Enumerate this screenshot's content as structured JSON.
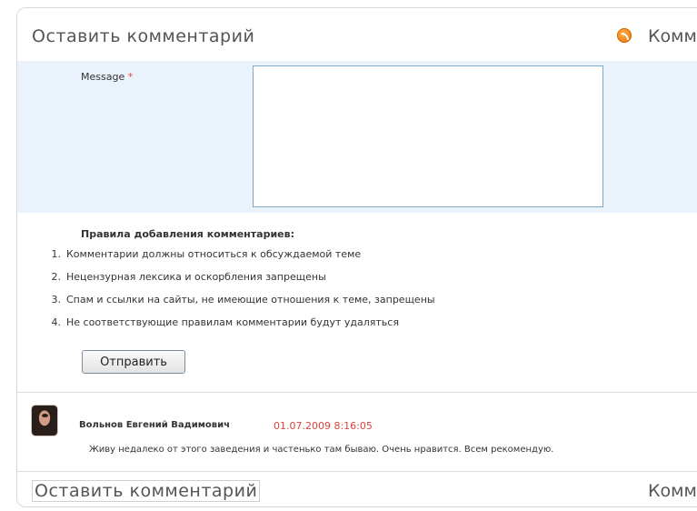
{
  "header": {
    "title": "Оставить комментарий",
    "comments_label": "Комм",
    "rss_icon": "rss-icon"
  },
  "form": {
    "message_label": "Message",
    "required_mark": "*",
    "message_value": ""
  },
  "rules": {
    "title": "Правила добавления комментариев:",
    "items": [
      {
        "num": "1.",
        "text": "Комментарии должны относиться к обсуждаемой теме"
      },
      {
        "num": "2.",
        "text": "Нецензурная лексика и оскорбления запрещены"
      },
      {
        "num": "3.",
        "text": "Спам и ссылки на сайты, не имеющие отношения к теме, запрещены"
      },
      {
        "num": "4.",
        "text": "Не соответствующие правилам комментарии будут удаляться"
      }
    ]
  },
  "submit_label": "Отправить",
  "comment": {
    "author": "Вольнов Евгений Вадимович",
    "date": "01.07.2009 8:16:05",
    "text": "Живу недалеко от этого заведения и частенько там бываю. Очень нравится. Всем рекомендую."
  },
  "footer": {
    "title": "Оставить комментарий",
    "comments_label": "Комм"
  },
  "colors": {
    "form_background": "#eaf3fb",
    "date_color": "#d8453b",
    "required_color": "#e0483b",
    "rss_color": "#e06a00"
  }
}
